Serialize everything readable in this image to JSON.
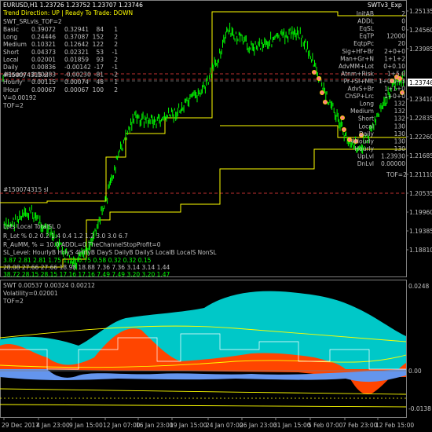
{
  "header": {
    "symbol_line": "EURUSD,H1  1.23726 1.23752 1.23707 1.23746",
    "trend_line": "Trend Direction:  UP  |  Ready To Trade:  DOWN",
    "indicator_name": "SWTv3_Exp"
  },
  "left_panel": {
    "title": "SWT_SRLvls_TOF=2",
    "rows": [
      {
        "name": "Basic",
        "v1": "0.39072",
        "v2": "0.32941",
        "v3": "84",
        "v4": "1"
      },
      {
        "name": "Long",
        "v1": "0.24446",
        "v2": "0.37087",
        "v3": "152",
        "v4": "2"
      },
      {
        "name": "Medium",
        "v1": "0.10321",
        "v2": "0.12642",
        "v3": "122",
        "v4": "2"
      },
      {
        "name": "Short",
        "v1": "0.04373",
        "v2": "0.02321",
        "v3": "53",
        "v4": "-1"
      },
      {
        "name": "Local",
        "v1": "0.02001",
        "v2": "0.01859",
        "v3": "93",
        "v4": "2"
      },
      {
        "name": "Daily",
        "v1": "0.00836",
        "v2": "-0.00142",
        "v3": "-17",
        "v4": "-1"
      },
      {
        "name": "4Hourly",
        "v1": "0.00283",
        "v2": "-0.00230",
        "v3": "-81",
        "v4": "-2"
      },
      {
        "name": "Hourly",
        "v1": "0.00115",
        "v2": "0.00074",
        "v3": "48",
        "v4": "1"
      },
      {
        "name": "IHour",
        "v1": "0.00067",
        "v2": "0.00067",
        "v3": "100",
        "v4": "2"
      }
    ],
    "v_line": "V=0.00192",
    "tof_line": "TOF=2"
  },
  "right_panel": {
    "rows": [
      {
        "label": "InitAB",
        "value": "2"
      },
      {
        "label": "ADDL",
        "value": "0"
      },
      {
        "label": "EqSL",
        "value": "0"
      },
      {
        "label": "EqTP",
        "value": "12000"
      },
      {
        "label": "EqtpPc",
        "value": "20"
      },
      {
        "label": "Sig+Hf+Br",
        "value": "2+0+0"
      },
      {
        "label": "Man+Gr+N",
        "value": "1+1+2"
      },
      {
        "label": "AdvMM+Lot",
        "value": "0+0.10"
      },
      {
        "label": "Atnm+Risk",
        "value": "1+5.0"
      },
      {
        "label": "Pr+Sl+Mlt",
        "value": "1+0.0+3"
      },
      {
        "label": "AdvS+Br",
        "value": "1+1+0"
      },
      {
        "label": "ChSP+Lrc",
        "value": "1+0+0"
      },
      {
        "label": "Long",
        "value": "132"
      },
      {
        "label": "Medium",
        "value": "132"
      },
      {
        "label": "Short",
        "value": "132"
      },
      {
        "label": "Local",
        "value": "130"
      },
      {
        "label": "Daily",
        "value": "130"
      },
      {
        "label": "4Hourly",
        "value": "130"
      },
      {
        "label": "Hourly",
        "value": "130"
      },
      {
        "label": "UpLvl",
        "value": "1.23930"
      },
      {
        "label": "DnLvl",
        "value": "0.00000"
      }
    ],
    "tof_line": "TOF=2"
  },
  "order_labels": [
    "#150074315 sl",
    "#150074315 sl",
    "#150074315 sl"
  ],
  "bottom_info": {
    "lots_line": "Lots  Local   TotalSL  0",
    "rlot_line": "R_Lot  %     0.2    0.2    1.4    0.4    1.2    1.2    3.0    3.0    6.7",
    "ram_line": "R_AuMM, %   =  10.0        ADDL=0              TheChannelStopProfit=0",
    "header_line": "SL_Level:  HourlyB  HrlyS  4HrlyB  DayS  DailyB  DailyS  LocalB  LocalS  NonSL",
    "row1": "3.87     2.81    2.81    1.75    1.72    0.75    0.58    0.32    0.32    0.15",
    "row2": "28.08    27.66   27.66   18.98   18.88   7.36    7.36    3.14    3.14    1.44",
    "row3": "38.72    28.15   28.15   17.16   17.16   7.49    7.49    3.20    3.20    1.47"
  },
  "price_axis": [
    "1.25135",
    "1.24560",
    "1.23985",
    "1.23746",
    "1.23410",
    "1.22835",
    "1.22260",
    "1.21685",
    "1.21110",
    "1.20535",
    "1.19960",
    "1.19385",
    "1.18810"
  ],
  "price_tag": "1.23746",
  "sub_window": {
    "title": "SWT 0.00537 0.00324 0.00212",
    "vol_line": "Volatility=0.02001",
    "tof_line": "TOF=2",
    "axis": [
      "0.0248",
      "0.00",
      "-0.0138"
    ]
  },
  "time_axis": [
    "29 Dec 2017",
    "4 Jan 23:00",
    "9 Jan 15:00",
    "12 Jan 07:00",
    "16 Jan 23:00",
    "19 Jan 15:00",
    "24 Jan 07:00",
    "26 Jan 23:00",
    "31 Jan 15:00",
    "5 Feb 07:00",
    "7 Feb 23:00",
    "12 Feb 15:00"
  ],
  "colors": {
    "price_bars": "#00ff00",
    "grid": "#7f7f7f",
    "yellow_line": "#ffff00",
    "cyan_fill": "#00c8c8",
    "orange_fill": "#ff4500",
    "blue_fill": "#6495ed",
    "text": "#c0c0c0",
    "header_yellow": "#ffff00"
  }
}
